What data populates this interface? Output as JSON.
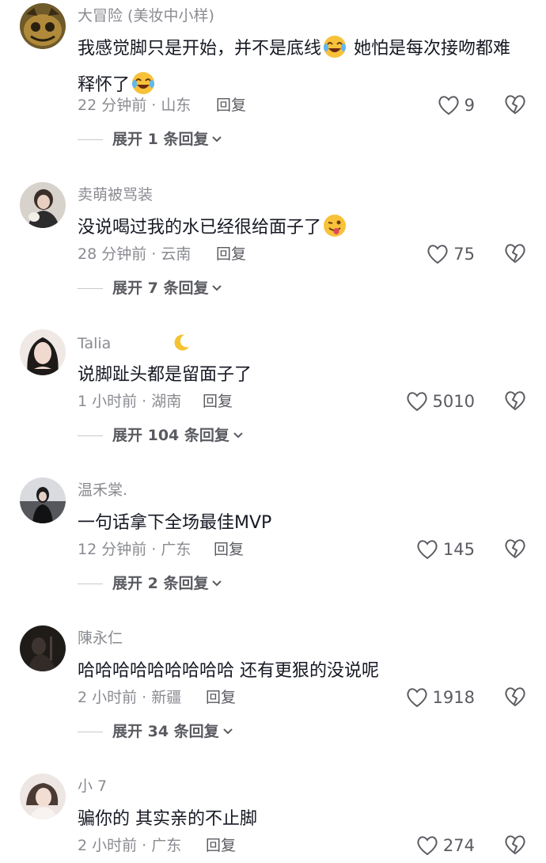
{
  "comments": [
    {
      "username": "大冒险 (美妆中小样)",
      "text_a": "我感觉脚只是开始，并不是底线",
      "text_b": " 她怕是每次接吻都难释怀了",
      "meta": "22 分钟前 · 山东",
      "reply": "回复",
      "likes": "9",
      "expand": "展开 1 条回复",
      "avatar_color": "#a07d36"
    },
    {
      "username": "卖萌被骂装",
      "text_a": "没说喝过我的水已经很给面子了",
      "meta": "28 分钟前 · 云南",
      "reply": "回复",
      "likes": "75",
      "expand": "展开 7 条回复",
      "avatar_color": "#8c7c70"
    },
    {
      "username": "Talia",
      "text_a": "说脚趾头都是留面子了",
      "meta": "1 小时前 · 湖南",
      "reply": "回复",
      "likes": "5010",
      "expand": "展开 104 条回复",
      "avatar_color": "#d9c3bb"
    },
    {
      "username": "温禾棠.",
      "text_a": "一句话拿下全场最佳MVP",
      "meta": "12 分钟前 · 广东",
      "reply": "回复",
      "likes": "145",
      "expand": "展开 2 条回复",
      "avatar_color": "#3c3e44"
    },
    {
      "username": "陳永仁",
      "text_a": "哈哈哈哈哈哈哈哈哈  还有更狠的没说呢",
      "meta": "2 小时前 · 新疆",
      "reply": "回复",
      "likes": "1918",
      "expand": "展开 34 条回复",
      "avatar_color": "#2b2522"
    },
    {
      "username": "小 7",
      "text_a": "骗你的 其实亲的不止脚",
      "meta": "2 小时前 · 广东",
      "reply": "回复",
      "likes": "274",
      "avatar_color": "#e3d6d0"
    }
  ],
  "icons": {
    "like": "heart-outline-icon",
    "dislike": "broken-heart-icon",
    "expand": "chevron-down-icon",
    "moon": "crescent-moon-icon"
  }
}
